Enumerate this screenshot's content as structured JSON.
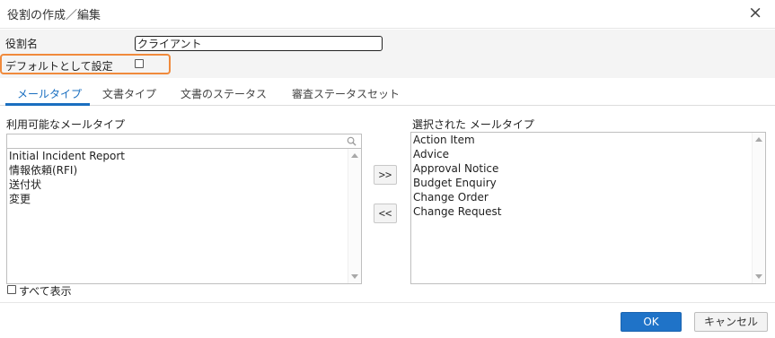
{
  "dialog": {
    "title": "役割の作成／編集",
    "close_icon": "×"
  },
  "form": {
    "role_label": "役割名",
    "role_value": "クライアント",
    "default_label": "デフォルトとして設定",
    "default_checked": false
  },
  "tabs": [
    {
      "label": "メールタイプ",
      "active": true
    },
    {
      "label": "文書タイプ",
      "active": false
    },
    {
      "label": "文書のステータス",
      "active": false
    },
    {
      "label": "審査ステータスセット",
      "active": false
    }
  ],
  "available": {
    "caption": "利用可能なメールタイプ",
    "search_placeholder": "",
    "items": [
      "Initial Incident Report",
      "情報依頼(RFI)",
      "送付状",
      "変更"
    ]
  },
  "selected": {
    "caption": "選択された メールタイプ",
    "items": [
      "Action Item",
      "Advice",
      "Approval Notice",
      "Budget Enquiry",
      "Change Order",
      "Change Request"
    ]
  },
  "move_buttons": {
    "add": ">>",
    "remove": "<<"
  },
  "show_all": {
    "label": "すべて表示",
    "checked": false
  },
  "footer": {
    "ok": "OK",
    "cancel": "キャンセル"
  },
  "colors": {
    "accent": "#1a6fc0",
    "highlight": "#f08a3c",
    "ok_button": "#1f73c8"
  }
}
